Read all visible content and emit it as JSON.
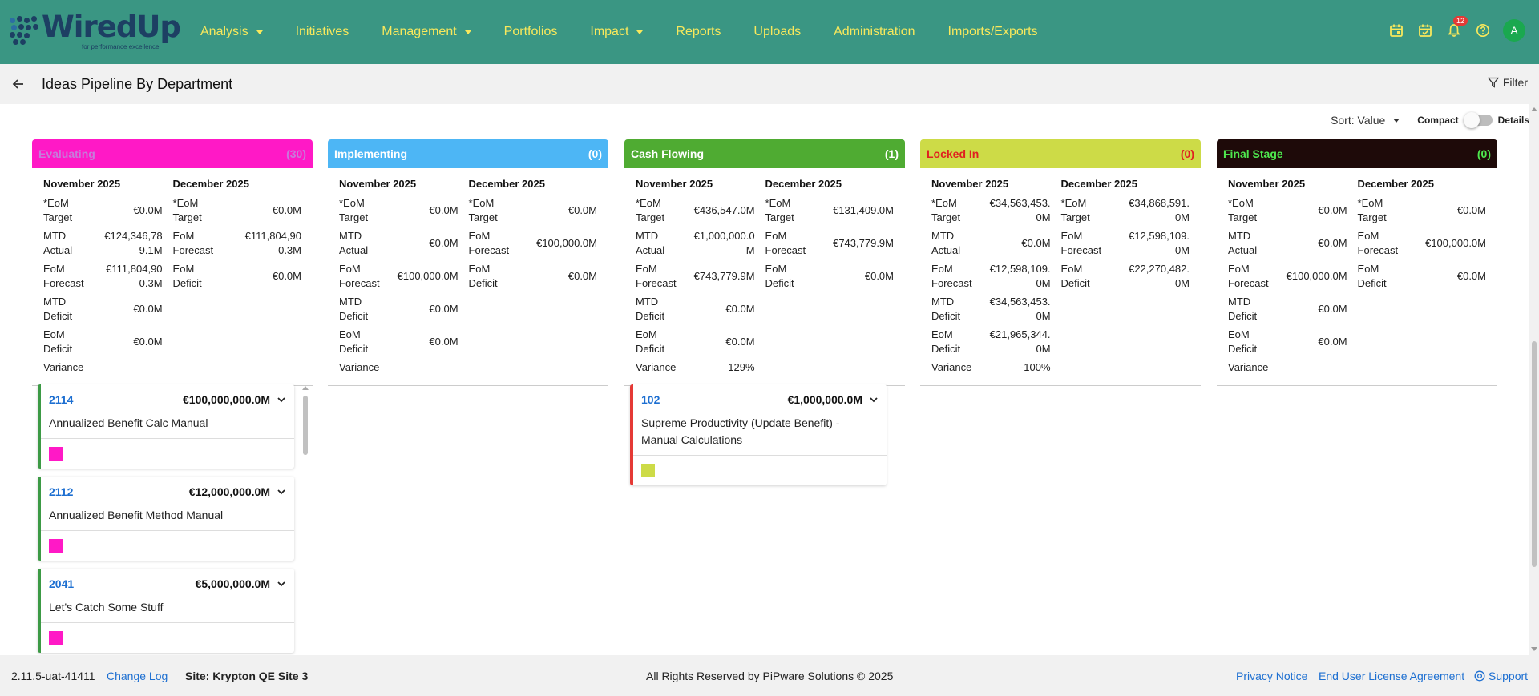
{
  "app": {
    "logo_text": "WiredUp",
    "logo_tagline": "for performance excellence"
  },
  "nav": {
    "items": [
      {
        "label": "Analysis",
        "dropdown": true
      },
      {
        "label": "Initiatives",
        "dropdown": false
      },
      {
        "label": "Management",
        "dropdown": true
      },
      {
        "label": "Portfolios",
        "dropdown": false
      },
      {
        "label": "Impact",
        "dropdown": true
      },
      {
        "label": "Reports",
        "dropdown": false
      },
      {
        "label": "Uploads",
        "dropdown": false
      },
      {
        "label": "Administration",
        "dropdown": false
      },
      {
        "label": "Imports/Exports",
        "dropdown": false
      }
    ],
    "icons": [
      "calendar-icon",
      "calendar-check-icon",
      "bell-icon",
      "help-icon"
    ],
    "notification_count": "12",
    "avatar_initial": "A"
  },
  "page": {
    "title": "Ideas Pipeline By Department",
    "filter_label": "Filter",
    "sort_label": "Sort: Value",
    "compact_label": "Compact",
    "details_label": "Details"
  },
  "columns": [
    {
      "name": "Evaluating",
      "count": "(30)",
      "header_bg": "#ff19c6",
      "header_color": "#c77bdb",
      "months": [
        {
          "month": "November 2025",
          "rows": [
            {
              "label": "*EoM Target",
              "value": "€0.0M"
            },
            {
              "label": "MTD Actual",
              "value": "€124,346,789.1M"
            },
            {
              "label": "EoM Forecast",
              "value": "€111,804,900.3M"
            },
            {
              "label": "MTD Deficit",
              "value": "€0.0M"
            },
            {
              "label": "EoM Deficit",
              "value": "€0.0M"
            },
            {
              "label": "Variance",
              "value": ""
            }
          ]
        },
        {
          "month": "December 2025",
          "rows": [
            {
              "label": "*EoM Target",
              "value": "€0.0M"
            },
            {
              "label": "EoM Forecast",
              "value": "€111,804,900.3M"
            },
            {
              "label": "EoM Deficit",
              "value": "€0.0M"
            }
          ]
        }
      ]
    },
    {
      "name": "Implementing",
      "count": "(0)",
      "header_bg": "#4db6f5",
      "header_color": "#ffffff",
      "months": [
        {
          "month": "November 2025",
          "rows": [
            {
              "label": "*EoM Target",
              "value": "€0.0M"
            },
            {
              "label": "MTD Actual",
              "value": "€0.0M"
            },
            {
              "label": "EoM Forecast",
              "value": "€100,000.0M"
            },
            {
              "label": "MTD Deficit",
              "value": "€0.0M"
            },
            {
              "label": "EoM Deficit",
              "value": "€0.0M"
            },
            {
              "label": "Variance",
              "value": ""
            }
          ]
        },
        {
          "month": "December 2025",
          "rows": [
            {
              "label": "*EoM Target",
              "value": "€0.0M"
            },
            {
              "label": "EoM Forecast",
              "value": "€100,000.0M"
            },
            {
              "label": "EoM Deficit",
              "value": "€0.0M"
            }
          ]
        }
      ]
    },
    {
      "name": "Cash Flowing",
      "count": "(1)",
      "header_bg": "#4fab32",
      "header_color": "#ffffff",
      "months": [
        {
          "month": "November 2025",
          "rows": [
            {
              "label": "*EoM Target",
              "value": "€436,547.0M"
            },
            {
              "label": "MTD Actual",
              "value": "€1,000,000.0M"
            },
            {
              "label": "EoM Forecast",
              "value": "€743,779.9M"
            },
            {
              "label": "MTD Deficit",
              "value": "€0.0M"
            },
            {
              "label": "EoM Deficit",
              "value": "€0.0M"
            },
            {
              "label": "Variance",
              "value": "129%"
            }
          ]
        },
        {
          "month": "December 2025",
          "rows": [
            {
              "label": "*EoM Target",
              "value": "€131,409.0M"
            },
            {
              "label": "EoM Forecast",
              "value": "€743,779.9M"
            },
            {
              "label": "EoM Deficit",
              "value": "€0.0M"
            }
          ]
        }
      ]
    },
    {
      "name": "Locked In",
      "count": "(0)",
      "header_bg": "#cddb47",
      "header_color": "#e02020",
      "months": [
        {
          "month": "November 2025",
          "rows": [
            {
              "label": "*EoM Target",
              "value": "€34,563,453.0M"
            },
            {
              "label": "MTD Actual",
              "value": "€0.0M"
            },
            {
              "label": "EoM Forecast",
              "value": "€12,598,109.0M"
            },
            {
              "label": "MTD Deficit",
              "value": "€34,563,453.0M"
            },
            {
              "label": "EoM Deficit",
              "value": "€21,965,344.0M"
            },
            {
              "label": "Variance",
              "value": "-100%"
            }
          ]
        },
        {
          "month": "December 2025",
          "rows": [
            {
              "label": "*EoM Target",
              "value": "€34,868,591.0M"
            },
            {
              "label": "EoM Forecast",
              "value": "€12,598,109.0M"
            },
            {
              "label": "EoM Deficit",
              "value": "€22,270,482.0M"
            }
          ]
        }
      ]
    },
    {
      "name": "Final Stage",
      "count": "(0)",
      "header_bg": "#1e0a09",
      "header_color": "#4ee84e",
      "months": [
        {
          "month": "November 2025",
          "rows": [
            {
              "label": "*EoM Target",
              "value": "€0.0M"
            },
            {
              "label": "MTD Actual",
              "value": "€0.0M"
            },
            {
              "label": "EoM Forecast",
              "value": "€100,000.0M"
            },
            {
              "label": "MTD Deficit",
              "value": "€0.0M"
            },
            {
              "label": "EoM Deficit",
              "value": "€0.0M"
            },
            {
              "label": "Variance",
              "value": ""
            }
          ]
        },
        {
          "month": "December 2025",
          "rows": [
            {
              "label": "*EoM Target",
              "value": "€0.0M"
            },
            {
              "label": "EoM Forecast",
              "value": "€100,000.0M"
            },
            {
              "label": "EoM Deficit",
              "value": "€0.0M"
            }
          ]
        }
      ]
    }
  ],
  "cards": {
    "evaluating": [
      {
        "id": "2114",
        "amount": "€100,000,000.0M",
        "title": "Annualized Benefit Calc Manual",
        "border": "#3c9a45",
        "swatch": "#ff19c6"
      },
      {
        "id": "2112",
        "amount": "€12,000,000.0M",
        "title": "Annualized Benefit Method Manual",
        "border": "#3c9a45",
        "swatch": "#ff19c6"
      },
      {
        "id": "2041",
        "amount": "€5,000,000.0M",
        "title": "Let's Catch Some Stuff",
        "border": "#3c9a45",
        "swatch": "#ff19c6"
      }
    ],
    "cash_flowing": [
      {
        "id": "102",
        "amount": "€1,000,000.0M",
        "title": "Supreme Productivity (Update Benefit) - Manual Calculations",
        "border": "#e53935",
        "swatch": "#cddb47"
      }
    ]
  },
  "footer": {
    "version": "2.11.5-uat-41411",
    "changelog": "Change Log",
    "site": "Site: Krypton QE Site 3",
    "rights": "All Rights Reserved by PiPware Solutions © 2025",
    "privacy": "Privacy Notice",
    "eula": "End User License Agreement",
    "support": "Support"
  }
}
